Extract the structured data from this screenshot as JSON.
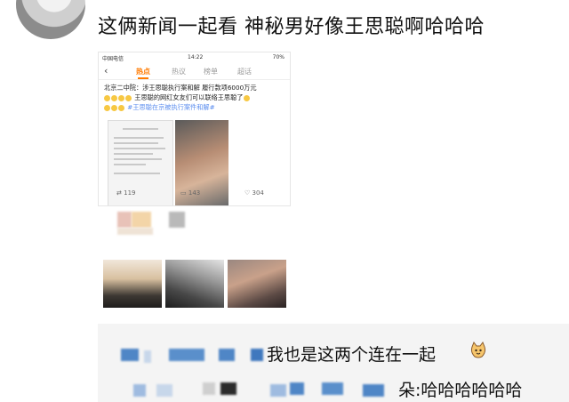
{
  "post": {
    "text": "这俩新闻一起看  神秘男好像王思聪啊哈哈哈"
  },
  "embedded_screenshot": {
    "status": {
      "carrier": "中国电信",
      "time": "14:22",
      "battery": "70%"
    },
    "tabs": [
      "热点",
      "热议",
      "榜单",
      "超话"
    ],
    "active_tab": "热点",
    "headline": "北京二中院：涉王思聪执行案和解 履行款项6000万元",
    "headline_2": "王思聪的网红女友们可以联络王思聪了",
    "hashtag": "#王思聪在京被执行案件和解#",
    "stats": {
      "reposts": "119",
      "comments": "143",
      "likes": "304"
    }
  },
  "comments": [
    {
      "text": "我也是这两个连在一起"
    },
    {
      "text": "朵:哈哈哈哈哈哈"
    }
  ],
  "colors": {
    "accent": "#ff7a00",
    "link": "#5b8def",
    "pixel_blue": "#4f86c6"
  },
  "icons": [
    "back-icon",
    "repost-icon",
    "comment-icon",
    "like-icon",
    "cat-emoji-icon"
  ]
}
